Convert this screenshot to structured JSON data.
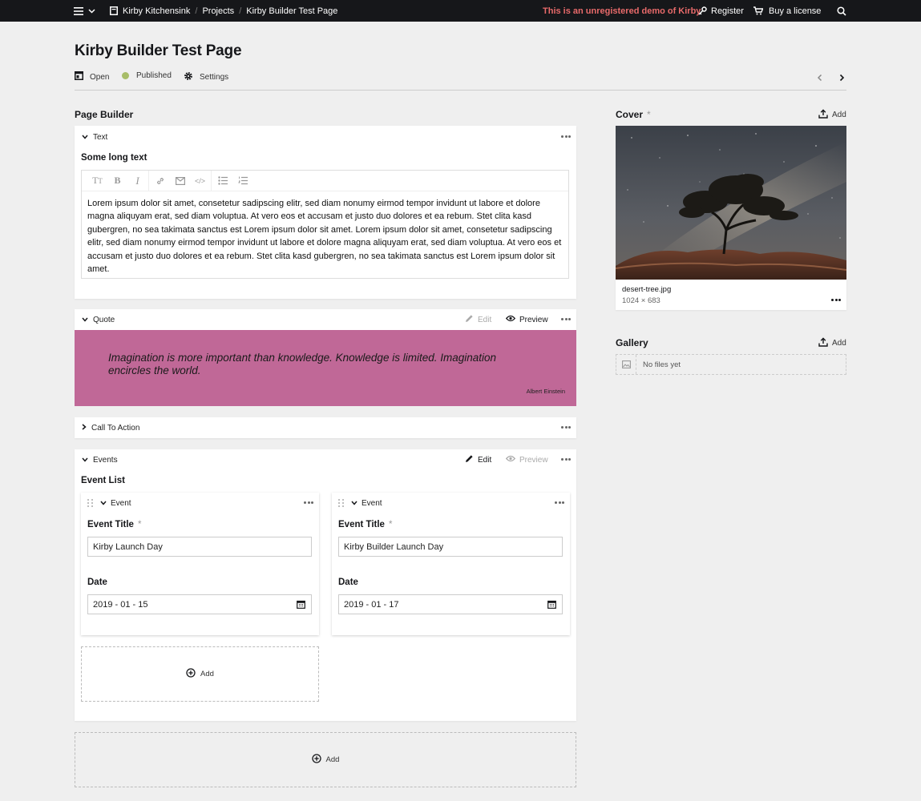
{
  "topbar": {
    "site_name": "Kirby Kitchensink",
    "breadcrumb": [
      "Projects",
      "Kirby Builder Test Page"
    ],
    "demo_notice": "This is an unregistered demo of Kirby",
    "register_label": "Register",
    "buy_label": "Buy a license"
  },
  "page": {
    "title": "Kirby Builder Test Page",
    "open_label": "Open",
    "status_label": "Published",
    "status_color": "#a7bd68",
    "settings_label": "Settings"
  },
  "builder": {
    "label": "Page Builder",
    "text_block": {
      "title": "Text",
      "field_label": "Some long text",
      "content": "Lorem ipsum dolor sit amet, consetetur sadipscing elitr, sed diam nonumy eirmod tempor invidunt ut labore et dolore magna aliquyam erat, sed diam voluptua. At vero eos et accusam et justo duo dolores et ea rebum. Stet clita kasd gubergren, no sea takimata sanctus est Lorem ipsum dolor sit amet. Lorem ipsum dolor sit amet, consetetur sadipscing elitr, sed diam nonumy eirmod tempor invidunt ut labore et dolore magna aliquyam erat, sed diam voluptua. At vero eos et accusam et justo duo dolores et ea rebum. Stet clita kasd gubergren, no sea takimata sanctus est Lorem ipsum dolor sit amet."
    },
    "quote_block": {
      "title": "Quote",
      "edit_label": "Edit",
      "preview_label": "Preview",
      "quote": "Imagination is more important than knowledge. Knowledge is limited. Imagination encircles the world.",
      "author": "Albert Einstein",
      "background_color": "#c06897"
    },
    "cta_block": {
      "title": "Call To Action"
    },
    "events_block": {
      "title": "Events",
      "edit_label": "Edit",
      "preview_label": "Preview",
      "list_label": "Event List",
      "events": [
        {
          "title": "Event",
          "title_label": "Event Title",
          "title_value": "Kirby Launch Day",
          "date_label": "Date",
          "date_value": "2019 - 01 - 15"
        },
        {
          "title": "Event",
          "title_label": "Event Title",
          "title_value": "Kirby Builder Launch Day",
          "date_label": "Date",
          "date_value": "2019 - 01 - 17"
        }
      ],
      "add_label": "Add"
    },
    "add_label": "Add"
  },
  "cover": {
    "label": "Cover",
    "required_mark": "*",
    "add_label": "Add",
    "filename": "desert-tree.jpg",
    "dimensions": "1024 × 683"
  },
  "gallery": {
    "label": "Gallery",
    "add_label": "Add",
    "empty_text": "No files yet"
  }
}
